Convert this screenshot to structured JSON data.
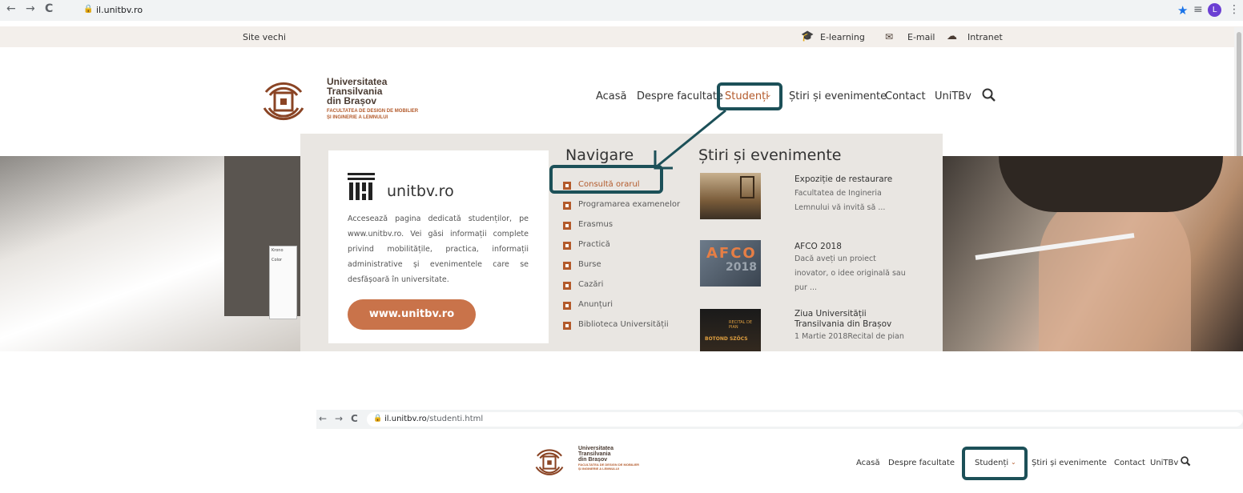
{
  "browser1": {
    "url": "il.unitbv.ro",
    "nav": [
      "←",
      "→",
      "C"
    ],
    "right_icons": [
      "★",
      "≡",
      "L",
      "⋮"
    ]
  },
  "topbar": {
    "old_site": "Site vechi",
    "elearning": "E-learning",
    "email": "E-mail",
    "intranet": "Intranet"
  },
  "logo": {
    "line1": "Universitatea",
    "line2": "Transilvania",
    "line3": "din Brașov",
    "fac1": "FACULTATEA DE DESIGN DE MOBILIER",
    "fac2": "ȘI INGINERIE A LEMNULUI"
  },
  "menu": {
    "home": "Acasă",
    "about": "Despre facultate",
    "students": "Studenți",
    "news": "Știri și evenimente",
    "contact": "Contact",
    "unitbv": "UniTBv"
  },
  "card": {
    "title": "unitbv.ro",
    "text": "Accesează pagina dedicată studenților, pe www.unitbv.ro. Vei găsi informații complete privind mobilitățile, practica, informații administrative și evenimentele care se desfășoară în universitate.",
    "button": "www.unitbv.ro"
  },
  "navigation": {
    "heading": "Navigare",
    "items": [
      "Consultă orarul",
      "Programarea examenelor",
      "Erasmus",
      "Practică",
      "Burse",
      "Cazări",
      "Anunțuri",
      "Biblioteca Universității"
    ]
  },
  "news": {
    "heading": "Știri și evenimente",
    "items": [
      {
        "title": "Expoziție de restaurare",
        "desc1": "Facultatea de Ingineria",
        "desc2": "Lemnului vă invită să ..."
      },
      {
        "title": "AFCO 2018",
        "desc1": "Dacă aveți un proiect",
        "desc2": "inovator, o idee originală sau",
        "desc3": "pur ..."
      },
      {
        "title": "Ziua Universității",
        "title2": "Transilvania din Brașov",
        "desc1": "1 Martie 2018Recital de pian"
      }
    ],
    "thumb2_text": "AFCO",
    "thumb2_year": "2018",
    "thumb3_text": "BOTOND SZŐCS",
    "thumb3_tag": "RECITAL DE PIAN"
  },
  "hero_card": {
    "brand": "Krono",
    "color_label": "Color"
  },
  "browser2": {
    "url_host": "il.unitbv.ro",
    "url_path": "/studenti.html"
  },
  "colors": {
    "accent": "#b35a2b",
    "highlight": "#1c5058",
    "button": "#c9734a"
  }
}
